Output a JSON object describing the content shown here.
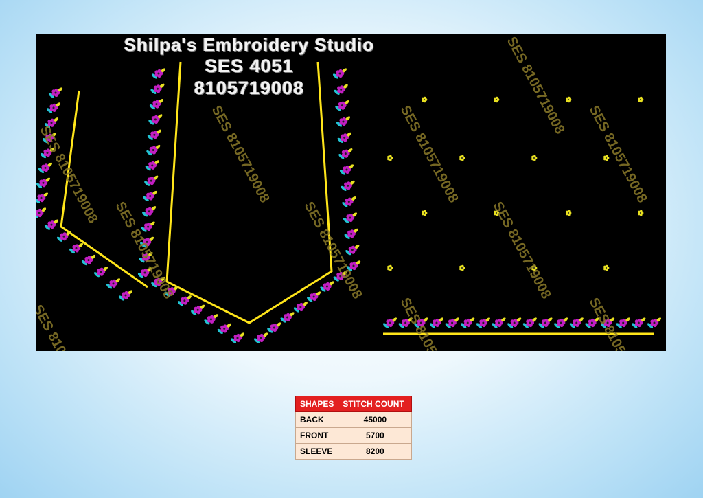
{
  "studio": {
    "name": "Shilpa's Embroidery Studio",
    "design_code": "SES  4051",
    "phone": "8105719008"
  },
  "watermark": "SES 8105719008",
  "colors": {
    "background": "#000000",
    "border": "#ffe51a",
    "flower": "#c21fc2",
    "leaf_cyan": "#22c4d4",
    "leaf_yellow": "#e8e020",
    "table_header": "#e32020",
    "table_cell": "#fde8d6"
  },
  "table": {
    "headers": [
      "SHAPES",
      "STITCH COUNT"
    ],
    "rows": [
      {
        "shape": "BACK",
        "count": "45000"
      },
      {
        "shape": "FRONT",
        "count": "5700"
      },
      {
        "shape": "SLEEVE",
        "count": "8200"
      }
    ]
  }
}
